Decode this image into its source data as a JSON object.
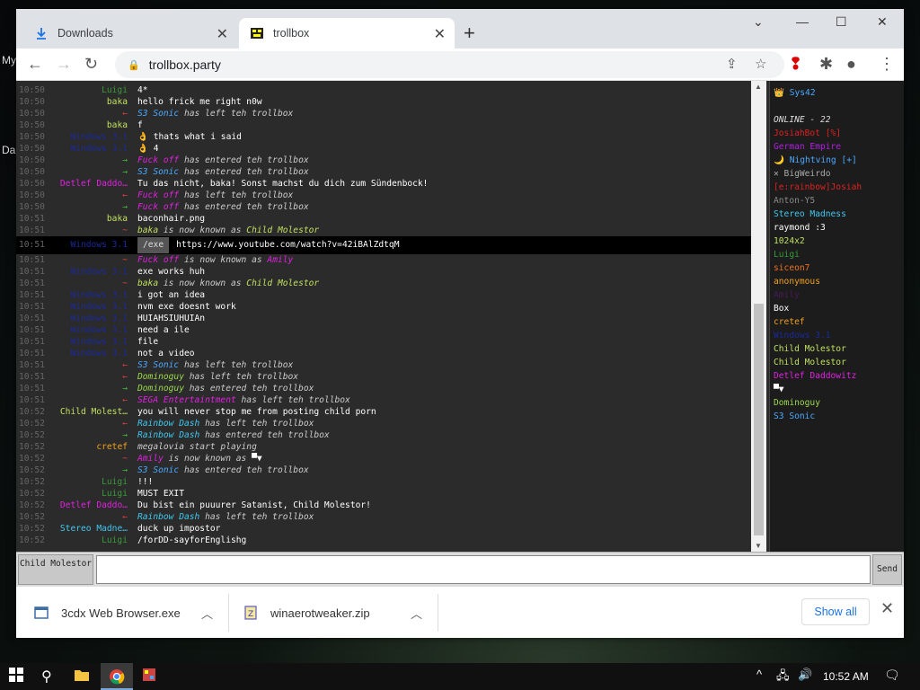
{
  "desktop": {
    "label_a": "My",
    "label_b": "Da"
  },
  "tabs": [
    {
      "label": "Downloads",
      "icon": "download-icon"
    },
    {
      "label": "trollbox",
      "icon": "trollbox-favicon"
    }
  ],
  "address": {
    "url": "trollbox.party"
  },
  "chat": [
    {
      "t": "10:50",
      "n": "Luigi",
      "nc": "#3a9a3a",
      "m": "4*",
      "mc": "#fff",
      "sys": false
    },
    {
      "t": "10:50",
      "n": "baka",
      "nc": "#c0e060",
      "m": "hello frick me right n0w",
      "mc": "#fff",
      "sys": false
    },
    {
      "t": "10:50",
      "n": "←",
      "nc": "#e04040",
      "m": "S3 Sonic",
      "mc": "#4aa8ff",
      "s": "has left teh trollbox",
      "sys": true
    },
    {
      "t": "10:50",
      "n": "baka",
      "nc": "#c0e060",
      "m": "f",
      "mc": "#fff",
      "sys": false
    },
    {
      "t": "10:50",
      "n": "Windows 3.1",
      "nc": "#1a2a9a",
      "m": "👌 thats what i said",
      "mc": "#fff",
      "sys": false
    },
    {
      "t": "10:50",
      "n": "Windows 3.1",
      "nc": "#1a2a9a",
      "m": "👌 4",
      "mc": "#fff",
      "sys": false
    },
    {
      "t": "10:50",
      "n": "→",
      "nc": "#40c040",
      "m": "Fuck off",
      "mc": "#e020e0",
      "s": "has entered teh trollbox",
      "sys": true
    },
    {
      "t": "10:50",
      "n": "→",
      "nc": "#40c040",
      "m": "S3 Sonic",
      "mc": "#4aa8ff",
      "s": "has entered teh trollbox",
      "sys": true
    },
    {
      "t": "10:50",
      "n": "Detlef Daddo…",
      "nc": "#e020e0",
      "m": "Tu das nicht, baka! Sonst machst du dich zum Sündenbock!",
      "mc": "#fff",
      "sys": false
    },
    {
      "t": "10:50",
      "n": "←",
      "nc": "#e04040",
      "m": "Fuck off",
      "mc": "#e020e0",
      "s": "has left teh trollbox",
      "sys": true
    },
    {
      "t": "10:50",
      "n": "→",
      "nc": "#40c040",
      "m": "Fuck off",
      "mc": "#e020e0",
      "s": "has entered teh trollbox",
      "sys": true
    },
    {
      "t": "10:51",
      "n": "baka",
      "nc": "#c0e060",
      "m": "baconhair.png",
      "mc": "#fff",
      "sys": false
    },
    {
      "t": "10:51",
      "n": "~",
      "nc": "#e04040",
      "m": "baka",
      "mc": "#c0e060",
      "s": "is now known as",
      "s2": "Child Molestor",
      "s2c": "#c0e060",
      "sys": true
    },
    {
      "t": "10:51",
      "n": "Windows 3.1",
      "nc": "#1a2a9a",
      "url": true,
      "exe": "/exe",
      "m": "https://www.youtube.com/watch?v=42iBAlZdtqM",
      "mc": "#fff",
      "sys": false
    },
    {
      "t": "10:51",
      "n": "~",
      "nc": "#e04040",
      "m": "Fuck off",
      "mc": "#e020e0",
      "s": "is now known as",
      "s2": "Amily",
      "s2c": "#e020e0",
      "sys": true
    },
    {
      "t": "10:51",
      "n": "Windows 3.1",
      "nc": "#1a2a9a",
      "m": "exe works huh",
      "mc": "#fff",
      "sys": false
    },
    {
      "t": "10:51",
      "n": "~",
      "nc": "#e04040",
      "m": "baka",
      "mc": "#c0e060",
      "s": "is now known as",
      "s2": "Child Molestor",
      "s2c": "#c0e060",
      "sys": true
    },
    {
      "t": "10:51",
      "n": "Windows 3.1",
      "nc": "#1a2a9a",
      "m": "i got an idea",
      "mc": "#fff",
      "sys": false
    },
    {
      "t": "10:51",
      "n": "Windows 3.1",
      "nc": "#1a2a9a",
      "m": "nvm exe doesnt work",
      "mc": "#fff",
      "sys": false
    },
    {
      "t": "10:51",
      "n": "Windows 3.1",
      "nc": "#1a2a9a",
      "m": "HUIAHSIUHUIAn",
      "mc": "#fff",
      "sys": false
    },
    {
      "t": "10:51",
      "n": "Windows 3.1",
      "nc": "#1a2a9a",
      "m": "need a ile",
      "mc": "#fff",
      "sys": false
    },
    {
      "t": "10:51",
      "n": "Windows 3.1",
      "nc": "#1a2a9a",
      "m": "file",
      "mc": "#fff",
      "sys": false
    },
    {
      "t": "10:51",
      "n": "Windows 3.1",
      "nc": "#1a2a9a",
      "m": "not a video",
      "mc": "#fff",
      "sys": false
    },
    {
      "t": "10:51",
      "n": "←",
      "nc": "#e04040",
      "m": "S3 Sonic",
      "mc": "#4aa8ff",
      "s": "has left teh trollbox",
      "sys": true
    },
    {
      "t": "10:51",
      "n": "←",
      "nc": "#e04040",
      "m": "Dominoguy",
      "mc": "#9ad84a",
      "s": "has left teh trollbox",
      "sys": true
    },
    {
      "t": "10:51",
      "n": "→",
      "nc": "#40c040",
      "m": "Dominoguy",
      "mc": "#9ad84a",
      "s": "has entered teh trollbox",
      "sys": true
    },
    {
      "t": "10:51",
      "n": "←",
      "nc": "#e04040",
      "m": "SEGA Entertaintment",
      "mc": "#e020e0",
      "s": "has left teh trollbox",
      "sys": true
    },
    {
      "t": "10:52",
      "n": "Child Molest…",
      "nc": "#c0e060",
      "m": "you will never stop me from posting child porn",
      "mc": "#fff",
      "sys": false
    },
    {
      "t": "10:52",
      "n": "←",
      "nc": "#e04040",
      "m": "Rainbow Dash",
      "mc": "#40c8f0",
      "s": "has left teh trollbox",
      "sys": true
    },
    {
      "t": "10:52",
      "n": "→",
      "nc": "#40c040",
      "m": "Rainbow Dash",
      "mc": "#40c8f0",
      "s": "has entered teh trollbox",
      "sys": true
    },
    {
      "t": "10:52",
      "n": "cretef",
      "nc": "#f0a020",
      "m": "megalovia start playing",
      "mc": "#ccc",
      "sys": false,
      "italic": true
    },
    {
      "t": "10:52",
      "n": "~",
      "nc": "#e04040",
      "m": "Amily",
      "mc": "#e020e0",
      "s": "is now known as",
      "s2": "▀▼",
      "s2c": "#fff",
      "sys": true
    },
    {
      "t": "10:52",
      "n": "→",
      "nc": "#40c040",
      "m": "S3 Sonic",
      "mc": "#4aa8ff",
      "s": "has entered teh trollbox",
      "sys": true
    },
    {
      "t": "10:52",
      "n": "Luigi",
      "nc": "#3a9a3a",
      "m": "!!!",
      "mc": "#fff",
      "sys": false
    },
    {
      "t": "10:52",
      "n": "Luigi",
      "nc": "#3a9a3a",
      "m": "MUST EXIT",
      "mc": "#fff",
      "sys": false
    },
    {
      "t": "10:52",
      "n": "Detlef Daddo…",
      "nc": "#e020e0",
      "m": "Du bist ein puuurer Satanist, Child Molestor!",
      "mc": "#fff",
      "sys": false
    },
    {
      "t": "10:52",
      "n": "←",
      "nc": "#e04040",
      "m": "Rainbow Dash",
      "mc": "#40c8f0",
      "s": "has left teh trollbox",
      "sys": true
    },
    {
      "t": "10:52",
      "n": "Stereo Madne…",
      "nc": "#40c8f0",
      "m": "duck up impostor",
      "mc": "#fff",
      "sys": false
    },
    {
      "t": "10:52",
      "n": "Luigi",
      "nc": "#3a9a3a",
      "m": "/forDD-sayforEnglishg",
      "mc": "#fff",
      "sys": false
    }
  ],
  "users": [
    {
      "name": "👑 Sys42",
      "c": "#4aa8ff"
    },
    {
      "name": "",
      "c": "#fff"
    },
    {
      "name": "ONLINE - 22",
      "c": "#ddd",
      "italic": true
    },
    {
      "name": "JosiahBot [%]",
      "c": "#e02020"
    },
    {
      "name": "German Empire",
      "c": "#b020e0"
    },
    {
      "name": "🌙 Nightving [+]",
      "c": "#4aa8ff"
    },
    {
      "name": "✕ BigWeirdo",
      "c": "#aaa"
    },
    {
      "name": "[e:rainbow]Josiah",
      "c": "#e02020"
    },
    {
      "name": "Anton-Y5",
      "c": "#888"
    },
    {
      "name": "Stereo Madness",
      "c": "#40c8f0"
    },
    {
      "name": "raymond :3",
      "c": "#fff"
    },
    {
      "name": "1024x2",
      "c": "#c0e060"
    },
    {
      "name": "Luigi",
      "c": "#3a9a3a"
    },
    {
      "name": "siceon7",
      "c": "#f07020"
    },
    {
      "name": "anonymous",
      "c": "#f0a020"
    },
    {
      "name": "Amily",
      "c": "#4a1a5a"
    },
    {
      "name": "Box",
      "c": "#fff"
    },
    {
      "name": "cretef",
      "c": "#f0a020"
    },
    {
      "name": "Windows 3.1",
      "c": "#1a2a9a"
    },
    {
      "name": "Child Molestor",
      "c": "#c0e060"
    },
    {
      "name": "Child Molestor",
      "c": "#c0e060"
    },
    {
      "name": "Detlef Daddowitz",
      "c": "#e020e0"
    },
    {
      "name": "▀▼",
      "c": "#fff"
    },
    {
      "name": "Dominoguy",
      "c": "#9ad84a"
    },
    {
      "name": "S3 Sonic",
      "c": "#4aa8ff"
    }
  ],
  "input": {
    "nick": "Child Molestor",
    "send": "Send",
    "value": ""
  },
  "downloads": [
    {
      "name": "3cdx Web Browser.exe",
      "icon": "exe-file-icon"
    },
    {
      "name": "winaerotweaker.zip",
      "icon": "zip-file-icon"
    }
  ],
  "shelf": {
    "show_all": "Show all"
  },
  "taskbar": {
    "time": "10:52 AM"
  }
}
